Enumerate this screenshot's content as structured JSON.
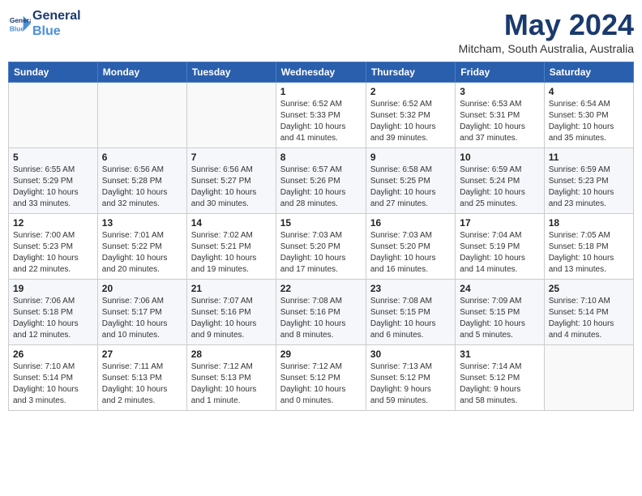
{
  "logo": {
    "line1": "General",
    "line2": "Blue"
  },
  "title": "May 2024",
  "location": "Mitcham, South Australia, Australia",
  "days_of_week": [
    "Sunday",
    "Monday",
    "Tuesday",
    "Wednesday",
    "Thursday",
    "Friday",
    "Saturday"
  ],
  "weeks": [
    [
      {
        "day": "",
        "info": ""
      },
      {
        "day": "",
        "info": ""
      },
      {
        "day": "",
        "info": ""
      },
      {
        "day": "1",
        "info": "Sunrise: 6:52 AM\nSunset: 5:33 PM\nDaylight: 10 hours\nand 41 minutes."
      },
      {
        "day": "2",
        "info": "Sunrise: 6:52 AM\nSunset: 5:32 PM\nDaylight: 10 hours\nand 39 minutes."
      },
      {
        "day": "3",
        "info": "Sunrise: 6:53 AM\nSunset: 5:31 PM\nDaylight: 10 hours\nand 37 minutes."
      },
      {
        "day": "4",
        "info": "Sunrise: 6:54 AM\nSunset: 5:30 PM\nDaylight: 10 hours\nand 35 minutes."
      }
    ],
    [
      {
        "day": "5",
        "info": "Sunrise: 6:55 AM\nSunset: 5:29 PM\nDaylight: 10 hours\nand 33 minutes."
      },
      {
        "day": "6",
        "info": "Sunrise: 6:56 AM\nSunset: 5:28 PM\nDaylight: 10 hours\nand 32 minutes."
      },
      {
        "day": "7",
        "info": "Sunrise: 6:56 AM\nSunset: 5:27 PM\nDaylight: 10 hours\nand 30 minutes."
      },
      {
        "day": "8",
        "info": "Sunrise: 6:57 AM\nSunset: 5:26 PM\nDaylight: 10 hours\nand 28 minutes."
      },
      {
        "day": "9",
        "info": "Sunrise: 6:58 AM\nSunset: 5:25 PM\nDaylight: 10 hours\nand 27 minutes."
      },
      {
        "day": "10",
        "info": "Sunrise: 6:59 AM\nSunset: 5:24 PM\nDaylight: 10 hours\nand 25 minutes."
      },
      {
        "day": "11",
        "info": "Sunrise: 6:59 AM\nSunset: 5:23 PM\nDaylight: 10 hours\nand 23 minutes."
      }
    ],
    [
      {
        "day": "12",
        "info": "Sunrise: 7:00 AM\nSunset: 5:23 PM\nDaylight: 10 hours\nand 22 minutes."
      },
      {
        "day": "13",
        "info": "Sunrise: 7:01 AM\nSunset: 5:22 PM\nDaylight: 10 hours\nand 20 minutes."
      },
      {
        "day": "14",
        "info": "Sunrise: 7:02 AM\nSunset: 5:21 PM\nDaylight: 10 hours\nand 19 minutes."
      },
      {
        "day": "15",
        "info": "Sunrise: 7:03 AM\nSunset: 5:20 PM\nDaylight: 10 hours\nand 17 minutes."
      },
      {
        "day": "16",
        "info": "Sunrise: 7:03 AM\nSunset: 5:20 PM\nDaylight: 10 hours\nand 16 minutes."
      },
      {
        "day": "17",
        "info": "Sunrise: 7:04 AM\nSunset: 5:19 PM\nDaylight: 10 hours\nand 14 minutes."
      },
      {
        "day": "18",
        "info": "Sunrise: 7:05 AM\nSunset: 5:18 PM\nDaylight: 10 hours\nand 13 minutes."
      }
    ],
    [
      {
        "day": "19",
        "info": "Sunrise: 7:06 AM\nSunset: 5:18 PM\nDaylight: 10 hours\nand 12 minutes."
      },
      {
        "day": "20",
        "info": "Sunrise: 7:06 AM\nSunset: 5:17 PM\nDaylight: 10 hours\nand 10 minutes."
      },
      {
        "day": "21",
        "info": "Sunrise: 7:07 AM\nSunset: 5:16 PM\nDaylight: 10 hours\nand 9 minutes."
      },
      {
        "day": "22",
        "info": "Sunrise: 7:08 AM\nSunset: 5:16 PM\nDaylight: 10 hours\nand 8 minutes."
      },
      {
        "day": "23",
        "info": "Sunrise: 7:08 AM\nSunset: 5:15 PM\nDaylight: 10 hours\nand 6 minutes."
      },
      {
        "day": "24",
        "info": "Sunrise: 7:09 AM\nSunset: 5:15 PM\nDaylight: 10 hours\nand 5 minutes."
      },
      {
        "day": "25",
        "info": "Sunrise: 7:10 AM\nSunset: 5:14 PM\nDaylight: 10 hours\nand 4 minutes."
      }
    ],
    [
      {
        "day": "26",
        "info": "Sunrise: 7:10 AM\nSunset: 5:14 PM\nDaylight: 10 hours\nand 3 minutes."
      },
      {
        "day": "27",
        "info": "Sunrise: 7:11 AM\nSunset: 5:13 PM\nDaylight: 10 hours\nand 2 minutes."
      },
      {
        "day": "28",
        "info": "Sunrise: 7:12 AM\nSunset: 5:13 PM\nDaylight: 10 hours\nand 1 minute."
      },
      {
        "day": "29",
        "info": "Sunrise: 7:12 AM\nSunset: 5:12 PM\nDaylight: 10 hours\nand 0 minutes."
      },
      {
        "day": "30",
        "info": "Sunrise: 7:13 AM\nSunset: 5:12 PM\nDaylight: 9 hours\nand 59 minutes."
      },
      {
        "day": "31",
        "info": "Sunrise: 7:14 AM\nSunset: 5:12 PM\nDaylight: 9 hours\nand 58 minutes."
      },
      {
        "day": "",
        "info": ""
      }
    ]
  ]
}
